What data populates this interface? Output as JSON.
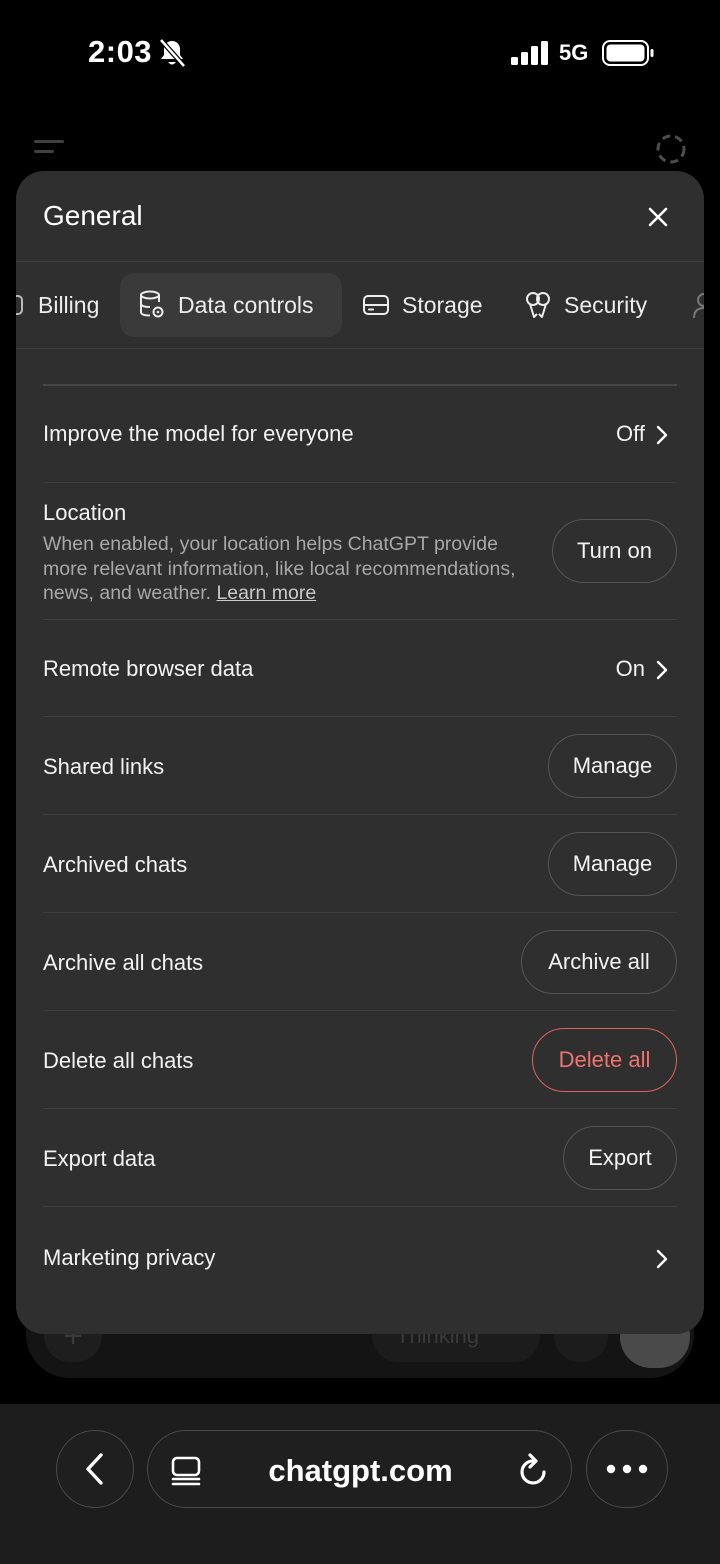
{
  "status_bar": {
    "time": "2:03",
    "network": "5G"
  },
  "background": {
    "thinking_label": "Thinking"
  },
  "modal": {
    "title": "General",
    "tabs": [
      {
        "label": "Billing",
        "icon": "billing-icon",
        "active": false
      },
      {
        "label": "Data controls",
        "icon": "database-settings-icon",
        "active": true
      },
      {
        "label": "Storage",
        "icon": "storage-icon",
        "active": false
      },
      {
        "label": "Security",
        "icon": "key-icon",
        "active": false
      }
    ],
    "settings": {
      "improve": {
        "label": "Improve the model for everyone",
        "value": "Off"
      },
      "location": {
        "label": "Location",
        "description": "When enabled, your location helps ChatGPT provide more relevant information, like local recommendations, news, and weather.",
        "link": "Learn more",
        "button": "Turn on"
      },
      "remote_browser": {
        "label": "Remote browser data",
        "value": "On"
      },
      "shared_links": {
        "label": "Shared links",
        "button": "Manage"
      },
      "archived_chats": {
        "label": "Archived chats",
        "button": "Manage"
      },
      "archive_all": {
        "label": "Archive all chats",
        "button": "Archive all"
      },
      "delete_all": {
        "label": "Delete all chats",
        "button": "Delete all"
      },
      "export": {
        "label": "Export data",
        "button": "Export"
      },
      "marketing": {
        "label": "Marketing privacy"
      }
    }
  },
  "browser": {
    "url": "chatgpt.com"
  },
  "colors": {
    "danger": "#f0736d",
    "modal_bg": "#2f2f2f"
  }
}
